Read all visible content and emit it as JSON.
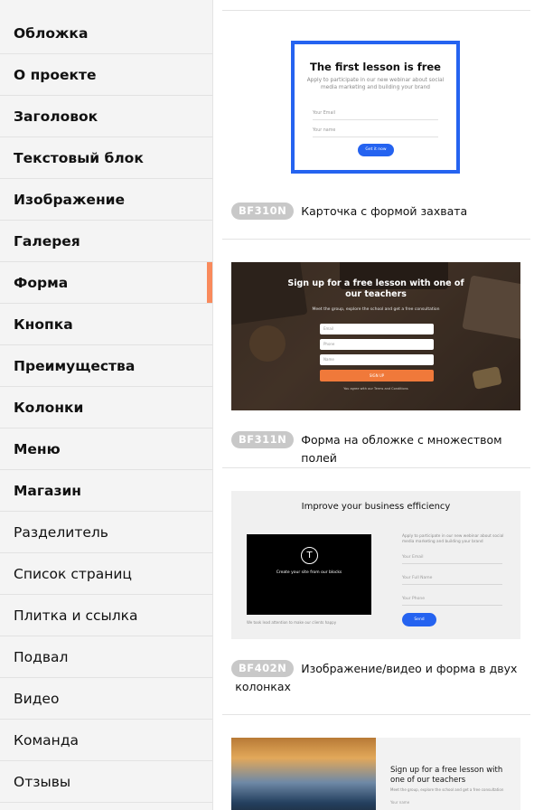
{
  "sidebar": {
    "items": [
      {
        "label": "Обложка",
        "bold": true
      },
      {
        "label": "О проекте",
        "bold": true
      },
      {
        "label": "Заголовок",
        "bold": true
      },
      {
        "label": "Текстовый блок",
        "bold": true
      },
      {
        "label": "Изображение",
        "bold": true
      },
      {
        "label": "Галерея",
        "bold": true
      },
      {
        "label": "Форма",
        "bold": true,
        "active": true
      },
      {
        "label": "Кнопка",
        "bold": true
      },
      {
        "label": "Преимущества",
        "bold": true
      },
      {
        "label": "Колонки",
        "bold": true
      },
      {
        "label": "Меню",
        "bold": true
      },
      {
        "label": "Магазин",
        "bold": true
      },
      {
        "label": "Разделитель",
        "bold": false
      },
      {
        "label": "Список страниц",
        "bold": false
      },
      {
        "label": "Плитка и ссылка",
        "bold": false
      },
      {
        "label": "Подвал",
        "bold": false
      },
      {
        "label": "Видео",
        "bold": false
      },
      {
        "label": "Команда",
        "bold": false
      },
      {
        "label": "Отзывы",
        "bold": false
      }
    ]
  },
  "cards": [
    {
      "code": "BF310N",
      "title": "Карточка с формой захвата",
      "preview": {
        "heading": "The first lesson is free",
        "subtext": "Apply to participate in our new webinar about social media marketing and building your brand",
        "fields": [
          "Your Email",
          "Your name"
        ],
        "button": "Get it now"
      }
    },
    {
      "code": "BF311N",
      "title": "Форма на обложке с множеством полей",
      "preview": {
        "heading": "Sign up for a free lesson with one of our teachers",
        "subtext": "Meet the group, explore the school and get a free consultation",
        "fields": [
          "Email",
          "Phone",
          "Name"
        ],
        "button": "SIGN UP",
        "note": "You agree with our Terms and Conditions"
      }
    },
    {
      "code": "BF402N",
      "title": "Изображение/видео и форма в двух колонках",
      "preview": {
        "heading": "Improve your business efficiency",
        "video_logo": "T",
        "video_text": "Create your site from our blocks",
        "caption": "We took lead attention to make our clients happy",
        "subtext": "Apply to participate in our new webinar about social media marketing and building your brand",
        "fields": [
          "Your Email",
          "Your Full Name",
          "Your Phone"
        ],
        "button": "Send"
      }
    },
    {
      "preview": {
        "heading": "Sign up for a free lesson with one of our teachers",
        "subtext": "Meet the group, explore the school and get a free consultation",
        "fields": [
          "Your name"
        ]
      }
    }
  ],
  "colors": {
    "accent_active": "#f98a5c",
    "blue": "#2563f0",
    "orange_button": "#f0793a",
    "badge": "#c8c8c8"
  }
}
